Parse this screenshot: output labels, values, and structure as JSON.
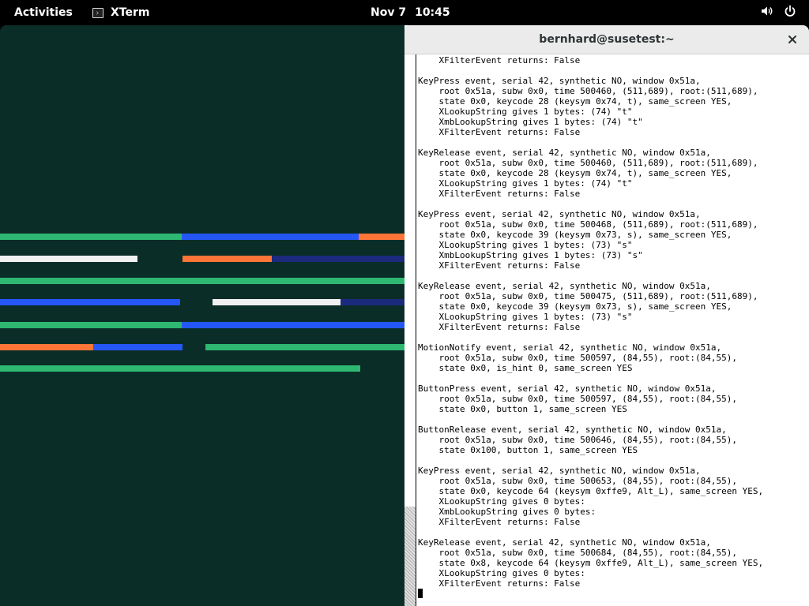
{
  "topbar": {
    "activities": "Activities",
    "app_name": "XTerm",
    "clock_date": "Nov 7",
    "clock_time": "10:45",
    "app_icon": "terminal-icon",
    "volume_icon": "volume-icon",
    "power_icon": "power-icon"
  },
  "visualizer": {
    "colors": {
      "background": "#0b2d27",
      "green": "#2eb872",
      "blue": "#2457f5",
      "orange": "#ff7538",
      "white": "#f0f0f0",
      "navy": "#1c2a7e"
    }
  },
  "xterm": {
    "title": "bernhard@susetest:~",
    "close_icon": "close-icon",
    "lines": [
      "    XFilterEvent returns: False",
      "",
      "KeyPress event, serial 42, synthetic NO, window 0x51a,",
      "    root 0x51a, subw 0x0, time 500460, (511,689), root:(511,689),",
      "    state 0x0, keycode 28 (keysym 0x74, t), same_screen YES,",
      "    XLookupString gives 1 bytes: (74) \"t\"",
      "    XmbLookupString gives 1 bytes: (74) \"t\"",
      "    XFilterEvent returns: False",
      "",
      "KeyRelease event, serial 42, synthetic NO, window 0x51a,",
      "    root 0x51a, subw 0x0, time 500460, (511,689), root:(511,689),",
      "    state 0x0, keycode 28 (keysym 0x74, t), same_screen YES,",
      "    XLookupString gives 1 bytes: (74) \"t\"",
      "    XFilterEvent returns: False",
      "",
      "KeyPress event, serial 42, synthetic NO, window 0x51a,",
      "    root 0x51a, subw 0x0, time 500468, (511,689), root:(511,689),",
      "    state 0x0, keycode 39 (keysym 0x73, s), same_screen YES,",
      "    XLookupString gives 1 bytes: (73) \"s\"",
      "    XmbLookupString gives 1 bytes: (73) \"s\"",
      "    XFilterEvent returns: False",
      "",
      "KeyRelease event, serial 42, synthetic NO, window 0x51a,",
      "    root 0x51a, subw 0x0, time 500475, (511,689), root:(511,689),",
      "    state 0x0, keycode 39 (keysym 0x73, s), same_screen YES,",
      "    XLookupString gives 1 bytes: (73) \"s\"",
      "    XFilterEvent returns: False",
      "",
      "MotionNotify event, serial 42, synthetic NO, window 0x51a,",
      "    root 0x51a, subw 0x0, time 500597, (84,55), root:(84,55),",
      "    state 0x0, is_hint 0, same_screen YES",
      "",
      "ButtonPress event, serial 42, synthetic NO, window 0x51a,",
      "    root 0x51a, subw 0x0, time 500597, (84,55), root:(84,55),",
      "    state 0x0, button 1, same_screen YES",
      "",
      "ButtonRelease event, serial 42, synthetic NO, window 0x51a,",
      "    root 0x51a, subw 0x0, time 500646, (84,55), root:(84,55),",
      "    state 0x100, button 1, same_screen YES",
      "",
      "KeyPress event, serial 42, synthetic NO, window 0x51a,",
      "    root 0x51a, subw 0x0, time 500653, (84,55), root:(84,55),",
      "    state 0x0, keycode 64 (keysym 0xffe9, Alt_L), same_screen YES,",
      "    XLookupString gives 0 bytes:",
      "    XmbLookupString gives 0 bytes:",
      "    XFilterEvent returns: False",
      "",
      "KeyRelease event, serial 42, synthetic NO, window 0x51a,",
      "    root 0x51a, subw 0x0, time 500684, (84,55), root:(84,55),",
      "    state 0x8, keycode 64 (keysym 0xffe9, Alt_L), same_screen YES,",
      "    XLookupString gives 0 bytes:",
      "    XFilterEvent returns: False"
    ]
  }
}
